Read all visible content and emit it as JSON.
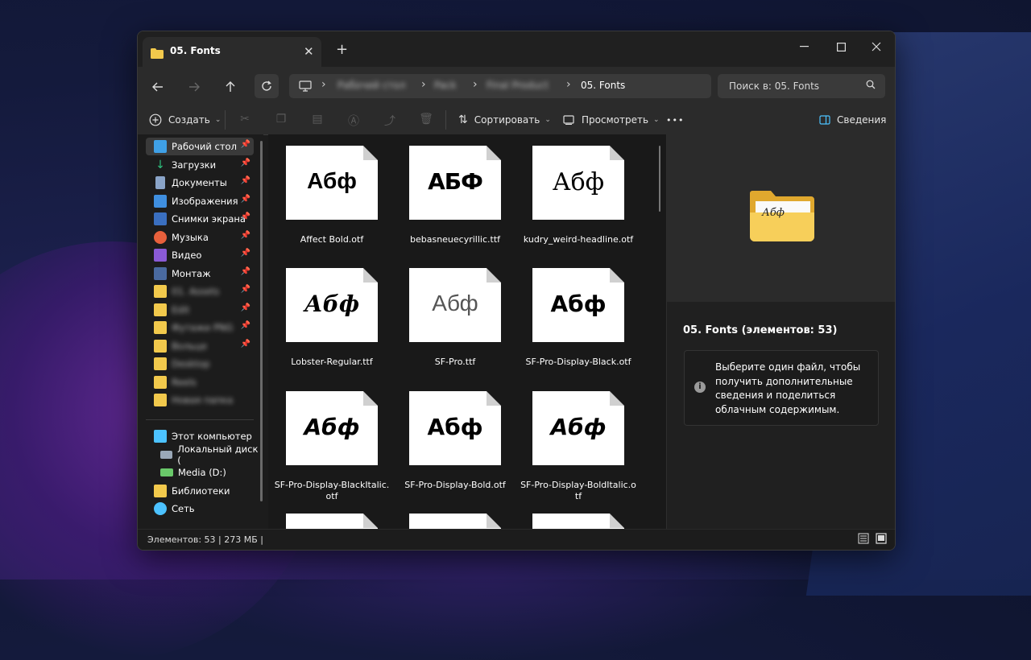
{
  "window": {
    "tab_title": "05. Fonts",
    "new_tab_symbol": "+"
  },
  "address": {
    "crumbs": [
      "Рабочий стол",
      "Pack",
      "Final Product",
      "05. Fonts"
    ],
    "search_placeholder": "Поиск в: 05. Fonts"
  },
  "toolbar": {
    "create_label": "Создать",
    "sort_label": "Сортировать",
    "view_label": "Просмотреть",
    "more_label": "•••",
    "details_label": "Сведения"
  },
  "sidebar": {
    "items": [
      {
        "label": "Рабочий стол",
        "color": "#3fa0e6"
      },
      {
        "label": "Загрузки",
        "color": "#2ec27e"
      },
      {
        "label": "Документы",
        "color": "#8aa4c8"
      },
      {
        "label": "Изображения",
        "color": "#3f8fe0"
      },
      {
        "label": "Снимки экрана",
        "color": "#3a6fc0"
      },
      {
        "label": "Музыка",
        "color": "#e8603c"
      },
      {
        "label": "Видео",
        "color": "#8a5ad6"
      },
      {
        "label": "Монтаж",
        "color": "#4a6aa0"
      }
    ],
    "blurred": [
      "01. Assets",
      "Edit",
      "Футажи PNG",
      "Вольце",
      "Desktop",
      "Reels",
      "Новая папка"
    ],
    "bottom": [
      {
        "label": "Этот компьютер"
      },
      {
        "label": "Локальный диск ("
      },
      {
        "label": "Media (D:)"
      },
      {
        "label": "Библиотеки"
      },
      {
        "label": "Сеть"
      }
    ]
  },
  "files": [
    {
      "name": "Affect Bold.otf",
      "glyph": "Абф"
    },
    {
      "name": "bebasneuecyrillic.ttf",
      "glyph": "АБФ"
    },
    {
      "name": "kudry_weird-headline.otf",
      "glyph": "Абф"
    },
    {
      "name": "Lobster-Regular.ttf",
      "glyph": "Абф"
    },
    {
      "name": "SF-Pro.ttf",
      "glyph": "Абф"
    },
    {
      "name": "SF-Pro-Display-Black.otf",
      "glyph": "Абф"
    },
    {
      "name": "SF-Pro-Display-BlackItalic.otf",
      "glyph": "Абф"
    },
    {
      "name": "SF-Pro-Display-Bold.otf",
      "glyph": "Абф"
    },
    {
      "name": "SF-Pro-Display-BoldItalic.otf",
      "glyph": "Абф"
    }
  ],
  "details": {
    "title": "05. Fonts (элементов: 53)",
    "info": "Выберите один файл, чтобы получить дополнительные сведения и поделиться облачным содержимым.",
    "preview_glyph": "Абф"
  },
  "status": {
    "text": "Элементов: 53   |   273 МБ   |"
  },
  "colors": {
    "folder": "#f2c94c",
    "accent": "#4cc2ff"
  }
}
